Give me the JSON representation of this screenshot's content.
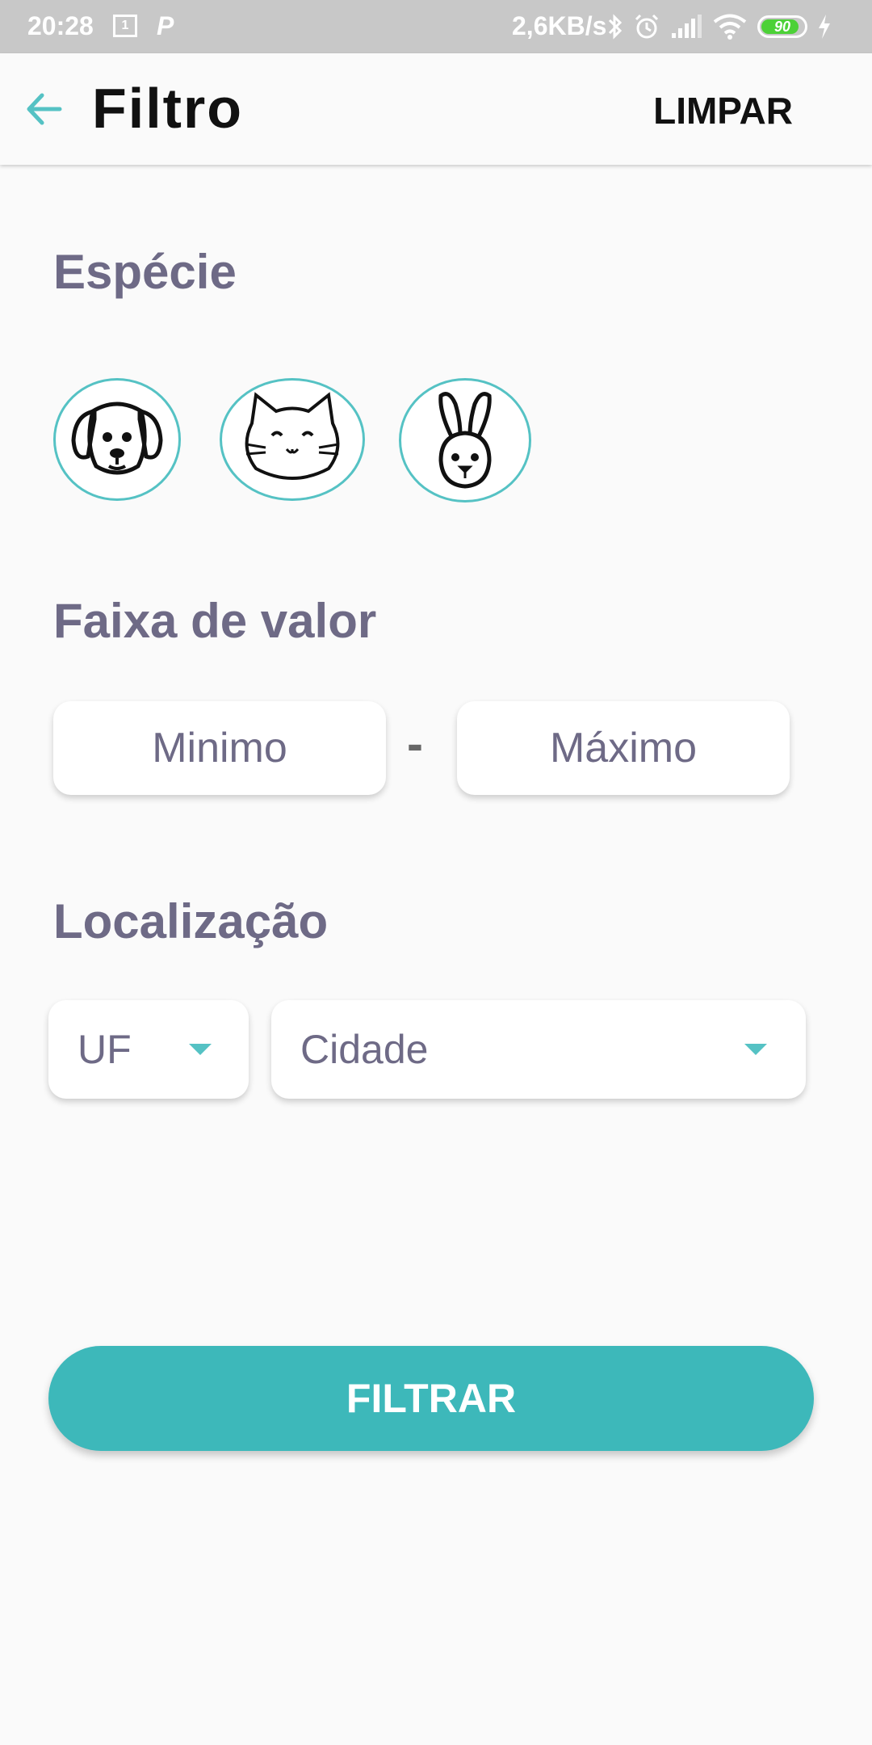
{
  "status_bar": {
    "time": "20:28",
    "sim_icon_label": "1",
    "net_speed": "2,6KB/s",
    "battery_level": 90,
    "battery_text": "90"
  },
  "app_bar": {
    "title": "Filtro",
    "clear_label": "LIMPAR"
  },
  "species_section": {
    "title": "Espécie",
    "options": [
      {
        "name": "dog",
        "icon": "dog-icon"
      },
      {
        "name": "cat",
        "icon": "cat-icon"
      },
      {
        "name": "rabbit",
        "icon": "rabbit-icon"
      }
    ]
  },
  "price_section": {
    "title": "Faixa de valor",
    "min_placeholder": "Minimo",
    "max_placeholder": "Máximo",
    "separator": "-"
  },
  "location_section": {
    "title": "Localização",
    "state_label": "UF",
    "city_label": "Cidade"
  },
  "filter_button_label": "FILTRAR",
  "colors": {
    "accent": "#3db8ba",
    "heading": "#6e6a86",
    "background": "#fafafa",
    "status_bar": "#c8c8c8"
  }
}
